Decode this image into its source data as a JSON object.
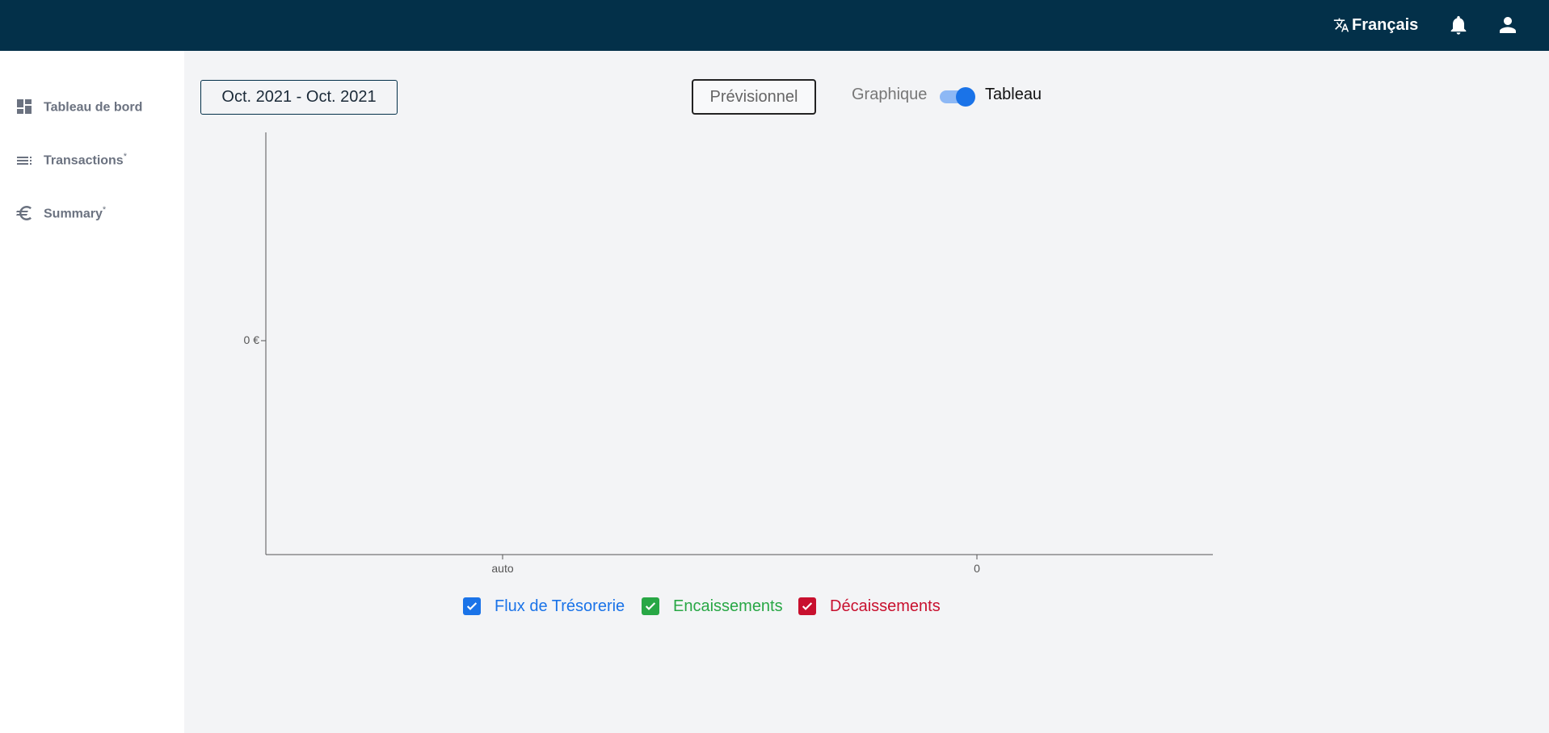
{
  "header": {
    "language": "Français",
    "icons": [
      "translate-icon",
      "bell-icon",
      "user-icon"
    ]
  },
  "sidebar": {
    "items": [
      {
        "label": "Tableau de bord",
        "sup": "",
        "icon": "dashboard-icon"
      },
      {
        "label": "Transactions",
        "sup": "*",
        "icon": "list-icon"
      },
      {
        "label": "Summary",
        "sup": "*",
        "icon": "euro-icon"
      }
    ]
  },
  "toolbar": {
    "date_range": "Oct. 2021 - Oct. 2021",
    "forecast_button": "Prévisionnel",
    "view_toggle": {
      "left_label": "Graphique",
      "right_label": "Tableau",
      "checked": true
    }
  },
  "chart_data": {
    "type": "bar",
    "categories": [
      "auto",
      "0"
    ],
    "series": [],
    "y_ticks": [
      "0 €"
    ],
    "title": "",
    "xlabel": "",
    "ylabel": ""
  },
  "legend": [
    {
      "label": "Flux de Trésorerie",
      "color": "#1a73e8",
      "checked": true
    },
    {
      "label": "Encaissements",
      "color": "#28a745",
      "checked": true
    },
    {
      "label": "Décaissements",
      "color": "#c8102e",
      "checked": true
    }
  ],
  "colors": {
    "header_bg": "#033049",
    "accent": "#1a73e8"
  }
}
